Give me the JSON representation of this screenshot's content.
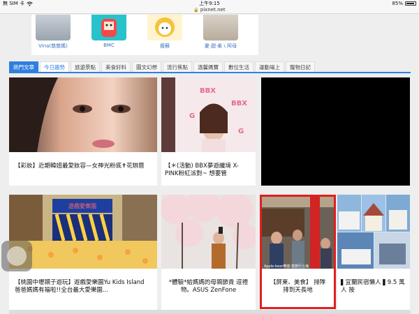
{
  "status_bar": {
    "carrier": "無 SIM 卡",
    "time": "上午9:15",
    "battery": "85%"
  },
  "url_bar": {
    "host": "pixnet.net"
  },
  "avatars": [
    {
      "label": "Vina(慈慈媽)"
    },
    {
      "label": "BMC"
    },
    {
      "label": "瘦蘇"
    },
    {
      "label": "夏‧甜‧柔 \\ 阿母"
    }
  ],
  "tabs": [
    "熱門文章",
    "今日趨勢",
    "旅遊景點",
    "美食好料",
    "圖文幻想",
    "流行焦點",
    "溫馨媽寶",
    "數位生活",
    "運動場上",
    "寵物日記"
  ],
  "articles": {
    "a1": {
      "title": "【彩妝】近期韓妞最愛妝容—女神光粉底✝花辦唇"
    },
    "a2": {
      "title": "【＊(活動) BBX夢遊纖境 X-PINK粉紅派對~ 想要管"
    },
    "a3": {
      "title": "【桃園中壢親子遊玩】遊戲愛樂園Yu Kids Island 爸爸媽媽有福啦!!全台最大愛樂園..."
    },
    "a4": {
      "title": "*體驗*給媽媽的母親節貴 逗禮物。ASUS ZenFone"
    },
    "a5": {
      "title": "【屏東、美食】 排隊排到天長地"
    },
    "a6": {
      "title": "▌宜蘭民宿懶人 ▌9.5 萬人 按"
    }
  },
  "photo_text": {
    "a3_sign": "遊戲愛樂園",
    "a5_watermark": "Apple-bear樂遊‧愛旅行七海"
  }
}
